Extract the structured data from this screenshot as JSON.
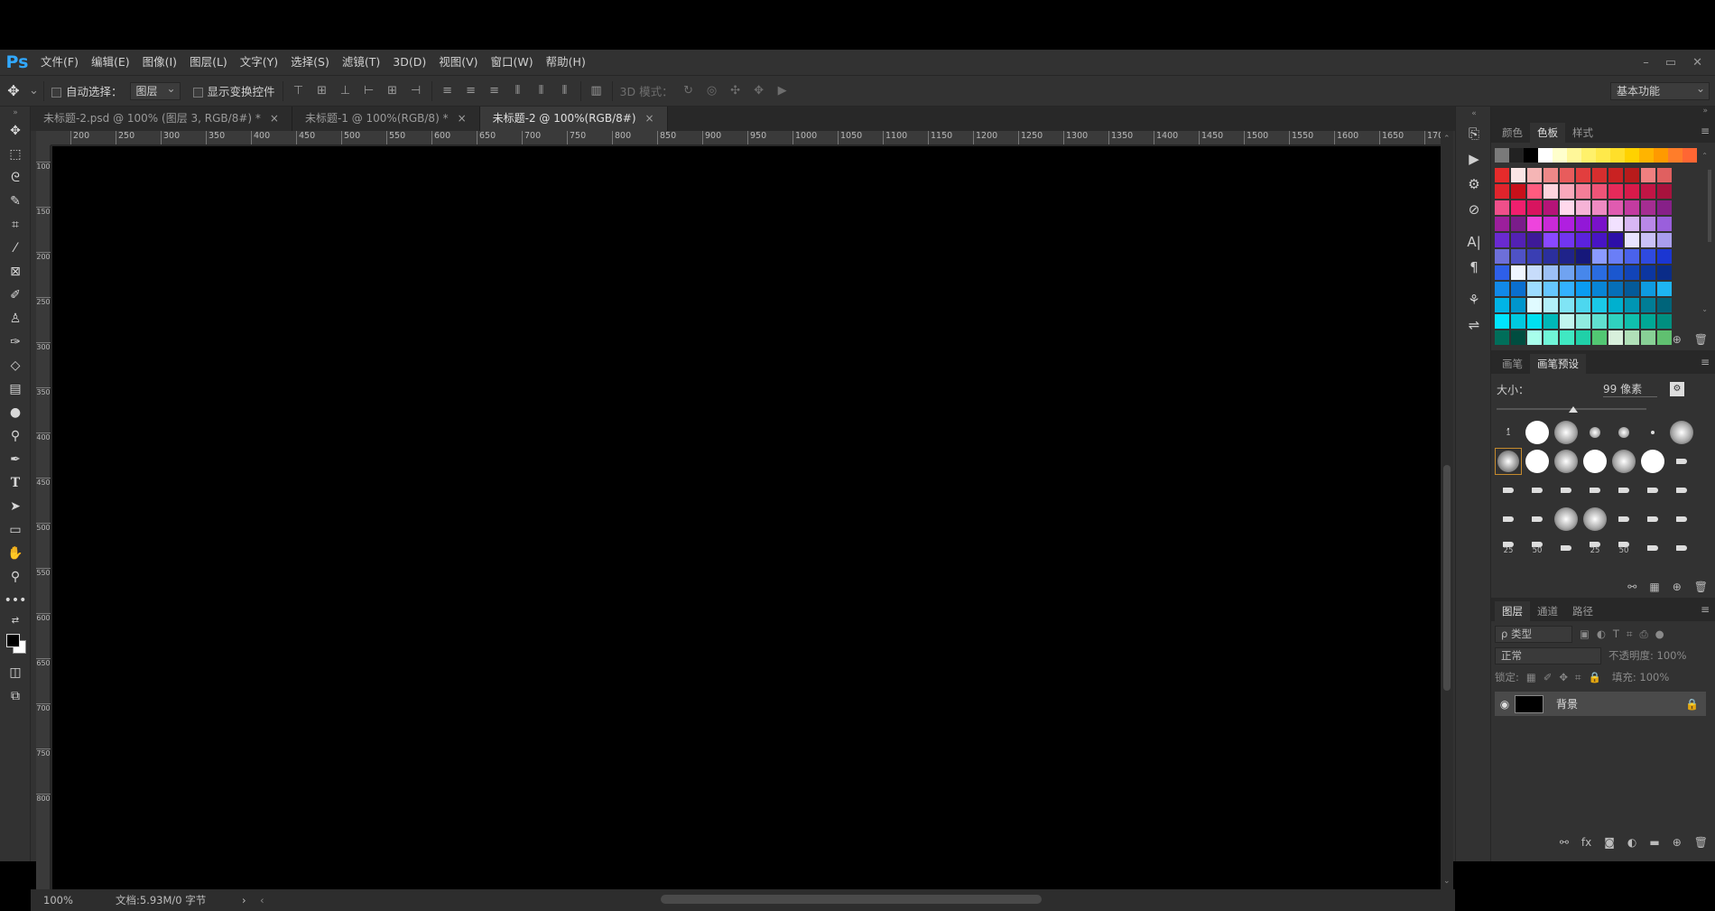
{
  "app": {
    "logo": "Ps"
  },
  "menu": [
    "文件(F)",
    "编辑(E)",
    "图像(I)",
    "图层(L)",
    "文字(Y)",
    "选择(S)",
    "滤镜(T)",
    "3D(D)",
    "视图(V)",
    "窗口(W)",
    "帮助(H)"
  ],
  "window_controls": {
    "minimize": "–",
    "restore": "▭",
    "close": "✕"
  },
  "options": {
    "auto_select_label": "自动选择：",
    "auto_select_value": "图层",
    "show_transform_label": "显示变换控件",
    "mode_3d_label": "3D 模式：",
    "workspace": "基本功能"
  },
  "tabs": [
    {
      "label": "未标题-2.psd @ 100% (图层 3, RGB/8#) *",
      "close": "×"
    },
    {
      "label": "未标题-1 @ 100%(RGB/8) *",
      "close": "×"
    },
    {
      "label": "未标题-2 @ 100%(RGB/8#)",
      "close": "×"
    }
  ],
  "ruler_h": [
    "200",
    "250",
    "300",
    "350",
    "400",
    "450",
    "500",
    "550",
    "600",
    "650",
    "700",
    "750",
    "800",
    "850",
    "900",
    "950",
    "1000",
    "1050",
    "1100",
    "1150",
    "1200",
    "1250",
    "1300",
    "1350",
    "1400",
    "1450",
    "1500",
    "1550",
    "1600",
    "1650",
    "170"
  ],
  "ruler_v": [
    "100",
    "150",
    "200",
    "250",
    "300",
    "350",
    "400",
    "450",
    "500",
    "550",
    "600",
    "650",
    "700",
    "750",
    "800"
  ],
  "status": {
    "zoom": "100%",
    "doc": "文档:5.93M/0 字节",
    "arrow": "›",
    "left_arrow": "‹"
  },
  "swatch_panel": {
    "tabs": [
      "颜色",
      "色板",
      "样式"
    ],
    "active": "色板"
  },
  "brush_panel": {
    "tabs": [
      "画笔",
      "画笔预设"
    ],
    "active": "画笔预设",
    "size_label": "大小：",
    "size_value": "99 像素"
  },
  "brush_numbers": {
    "r1": "1",
    "r5a": "25",
    "r5b": "50",
    "r5c": "25",
    "r5d": "50"
  },
  "layers_panel": {
    "tabs": [
      "图层",
      "通道",
      "路径"
    ],
    "active": "图层",
    "filter_placeholder": "ρ 类型",
    "blend_mode": "正常",
    "opacity_label": "不透明度: 100%",
    "lock_label": "锁定:",
    "fill_label": "填充: 100%",
    "layer_name": "背景"
  },
  "colors": {
    "accent": "#31a8ff",
    "panel": "#323232",
    "canvas": "#000000"
  }
}
